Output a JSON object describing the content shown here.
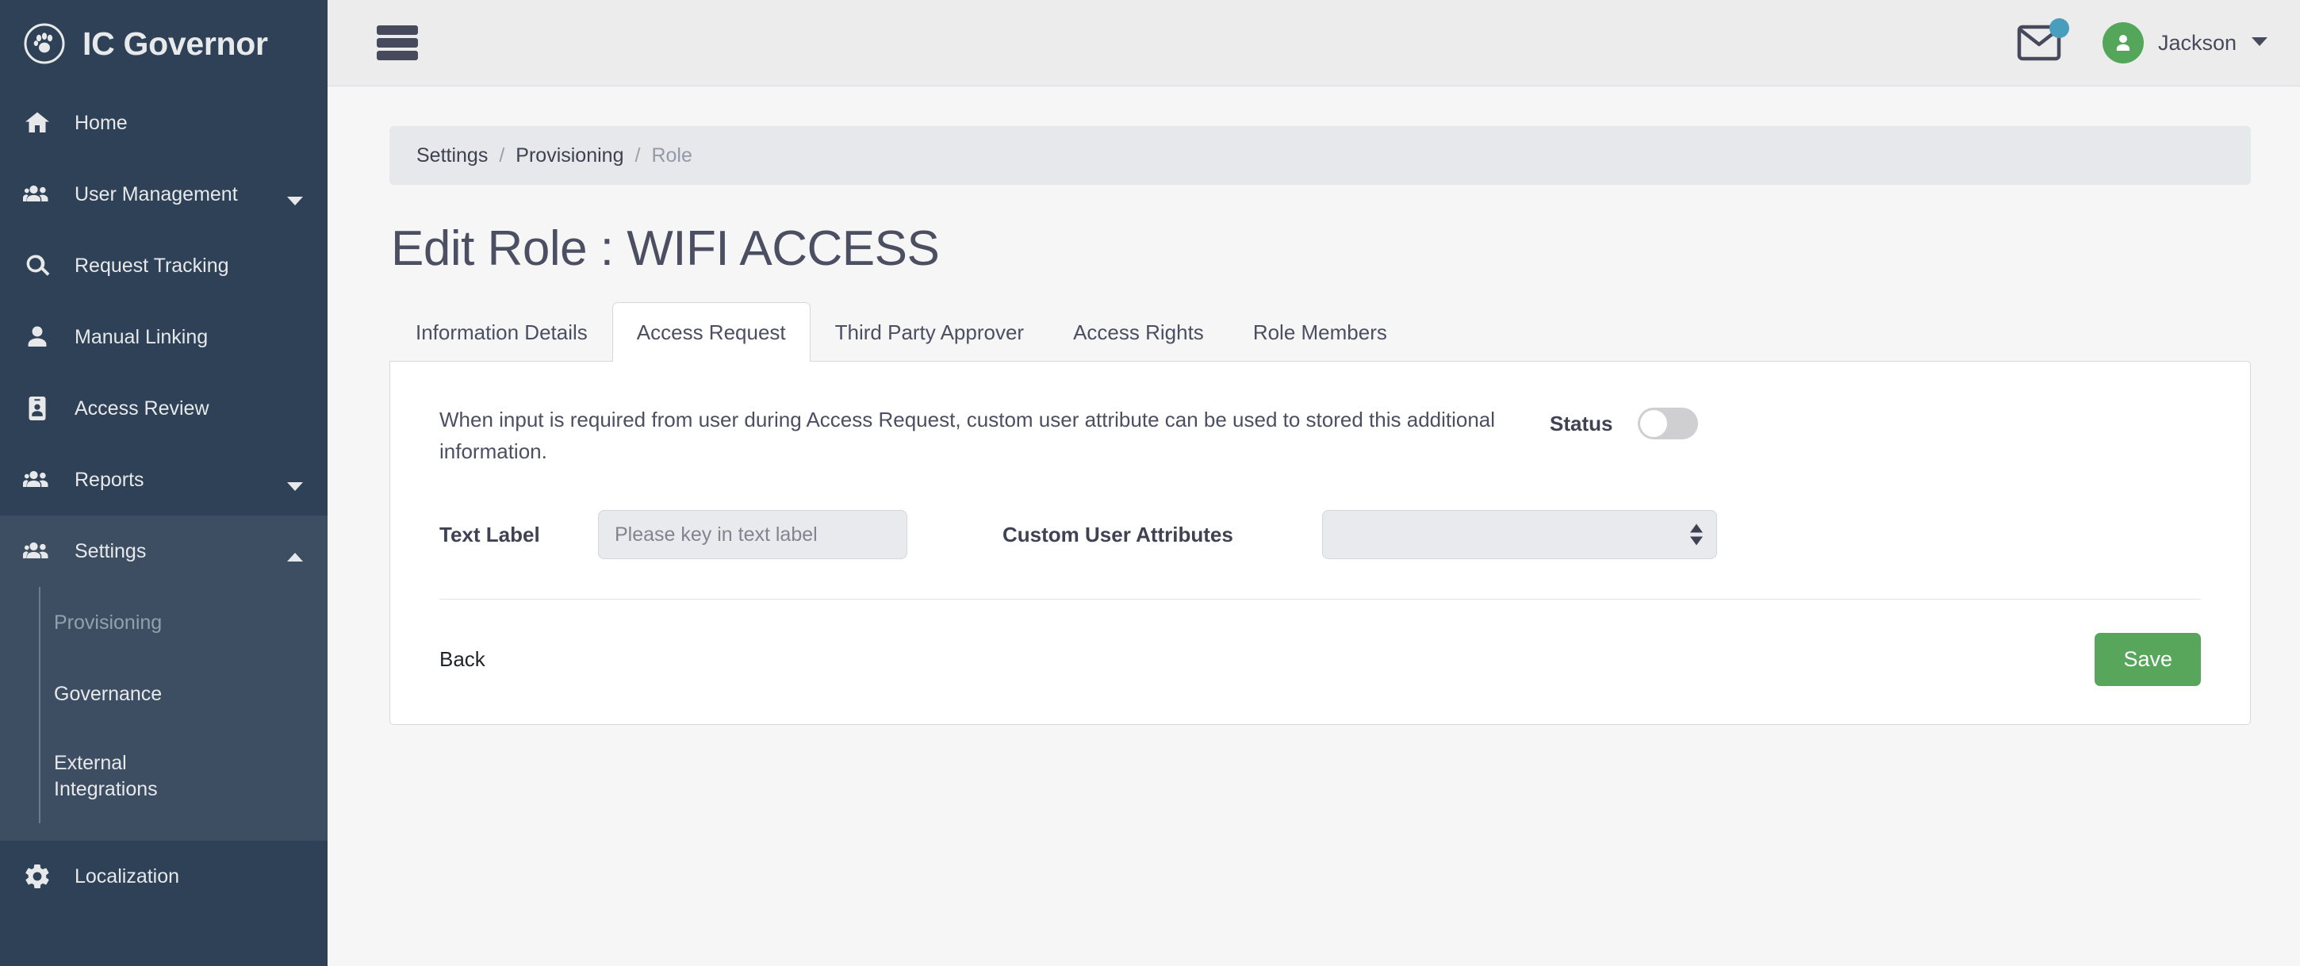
{
  "brand": {
    "name": "IC Governor",
    "logo_icon": "paw-circle-icon"
  },
  "sidebar": {
    "items": [
      {
        "label": "Home",
        "icon": "home-icon"
      },
      {
        "label": "User Management",
        "icon": "users-icon",
        "caret": "chevron-down-icon"
      },
      {
        "label": "Request Tracking",
        "icon": "search-icon"
      },
      {
        "label": "Manual Linking",
        "icon": "user-icon"
      },
      {
        "label": "Access Review",
        "icon": "id-badge-icon"
      },
      {
        "label": "Reports",
        "icon": "users-icon",
        "caret": "chevron-down-icon"
      },
      {
        "label": "Settings",
        "icon": "users-icon",
        "caret": "chevron-up-icon"
      },
      {
        "label": "Localization",
        "icon": "gear-icon"
      }
    ],
    "settings_sub_items": [
      {
        "label": "Provisioning",
        "active": true
      },
      {
        "label": "Governance",
        "active": false
      },
      {
        "label": "External Integrations",
        "active": false
      }
    ]
  },
  "topbar": {
    "menu_icon": "hamburger-icon",
    "mail_icon": "envelope-icon",
    "mail_badge_color": "#4a9ebd",
    "avatar_icon": "user-avatar-icon",
    "avatar_color": "#54a75a",
    "user_name": "Jackson",
    "user_caret": "chevron-down-icon"
  },
  "breadcrumb": {
    "items": [
      "Settings",
      "Provisioning",
      "Role"
    ],
    "separator": "/"
  },
  "page": {
    "title": "Edit Role : WIFI ACCESS"
  },
  "tabs": [
    {
      "label": "Information Details",
      "active": false
    },
    {
      "label": "Access Request",
      "active": true
    },
    {
      "label": "Third Party Approver",
      "active": false
    },
    {
      "label": "Access Rights",
      "active": false
    },
    {
      "label": "Role Members",
      "active": false
    }
  ],
  "panel": {
    "intro": "When input is required from user during Access Request, custom user attribute can be used to stored this additional information.",
    "status_label": "Status",
    "status_on": false,
    "text_label": "Text Label",
    "text_placeholder": "Please key in text label",
    "text_value": "",
    "custom_attr_label": "Custom User Attributes",
    "custom_attr_value": "",
    "back_label": "Back",
    "save_label": "Save",
    "save_color": "#58a55c"
  }
}
